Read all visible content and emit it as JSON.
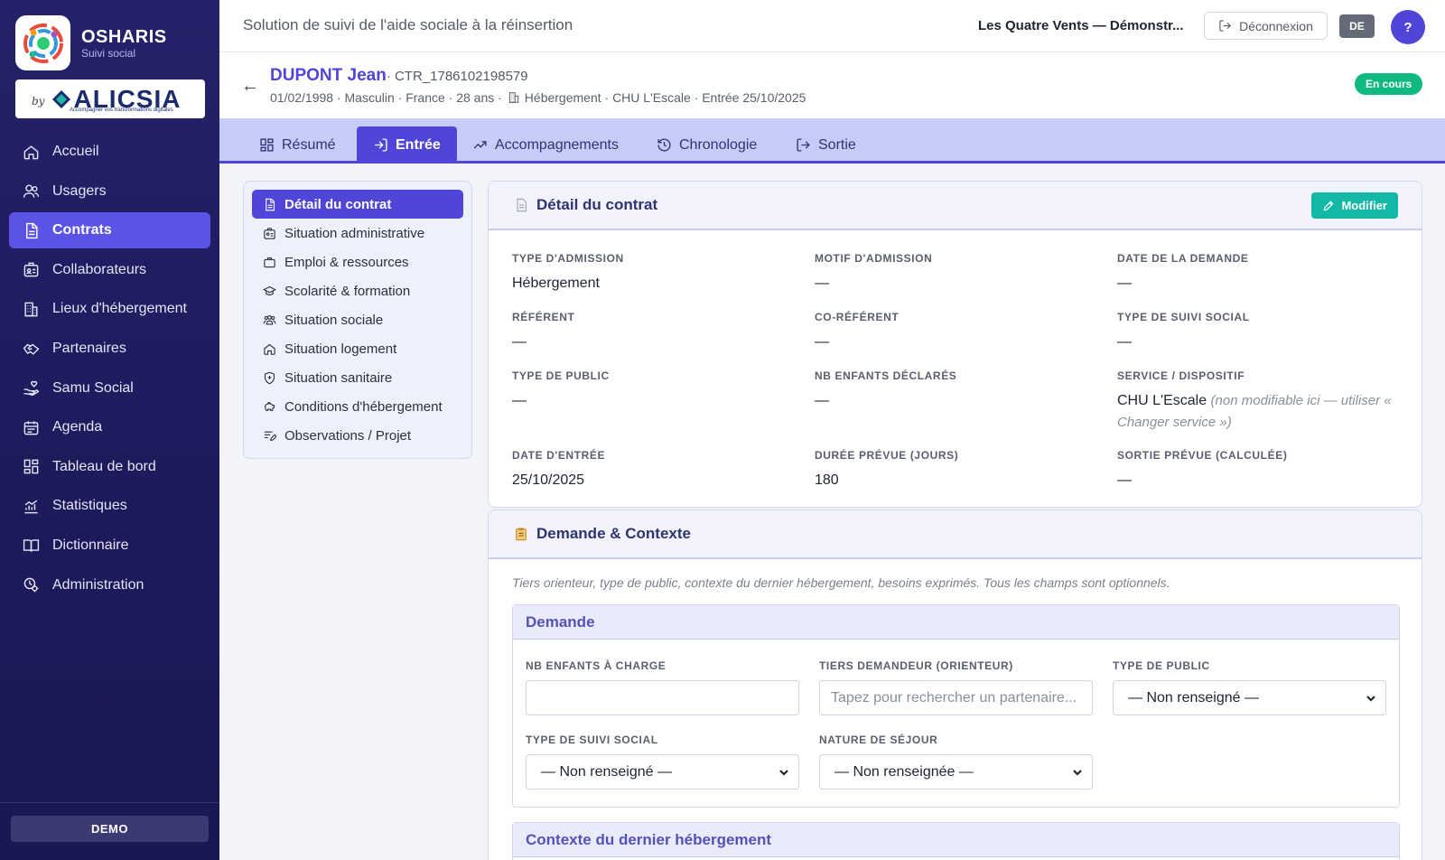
{
  "brand": {
    "name": "OSHARIS",
    "subtitle": "Suivi social",
    "logo_icon": "osharis-logo-icon"
  },
  "partner": {
    "by": "by",
    "name": "ALICSIA",
    "tagline": "Accompagner vos transformations digitales"
  },
  "sidebar": {
    "items": [
      {
        "label": "Accueil",
        "icon": "home-icon"
      },
      {
        "label": "Usagers",
        "icon": "users-icon"
      },
      {
        "label": "Contrats",
        "icon": "document-icon"
      },
      {
        "label": "Collaborateurs",
        "icon": "id-card-icon"
      },
      {
        "label": "Lieux d'hébergement",
        "icon": "building-icon"
      },
      {
        "label": "Partenaires",
        "icon": "handshake-icon"
      },
      {
        "label": "Samu Social",
        "icon": "hand-heart-icon"
      },
      {
        "label": "Agenda",
        "icon": "calendar-icon"
      },
      {
        "label": "Tableau de bord",
        "icon": "dashboard-icon"
      },
      {
        "label": "Statistiques",
        "icon": "stats-icon"
      },
      {
        "label": "Dictionnaire",
        "icon": "book-icon"
      },
      {
        "label": "Administration",
        "icon": "admin-gear-icon"
      }
    ],
    "active_index": 2,
    "demo_label": "DEMO"
  },
  "topbar": {
    "title": "Solution de suivi de l'aide sociale à la réinsertion",
    "org": "Les Quatre Vents — Démonstr...",
    "logout_label": "Déconnexion",
    "lang_label": "DE",
    "help_label": "?"
  },
  "patient": {
    "name": "DUPONT Jean",
    "ref": "· CTR_1786102198579",
    "meta_before": "01/02/1998 · Masculin · France · 28 ans ·",
    "meta_after": "Hébergement · CHU L'Escale · Entrée 25/10/2025",
    "status": "En cours",
    "back_label": "←"
  },
  "tabs": [
    {
      "label": "Résumé",
      "icon": "grid-icon"
    },
    {
      "label": "Entrée",
      "icon": "login-icon"
    },
    {
      "label": "Accompagnements",
      "icon": "trend-icon"
    },
    {
      "label": "Chronologie",
      "icon": "history-icon"
    },
    {
      "label": "Sortie",
      "icon": "logout-icon"
    }
  ],
  "subnav": [
    {
      "label": "Détail du contrat",
      "icon": "document-icon"
    },
    {
      "label": "Situation administrative",
      "icon": "id-card-icon"
    },
    {
      "label": "Emploi & ressources",
      "icon": "briefcase-icon"
    },
    {
      "label": "Scolarité & formation",
      "icon": "graduation-icon"
    },
    {
      "label": "Situation sociale",
      "icon": "people-icon"
    },
    {
      "label": "Situation logement",
      "icon": "home-icon"
    },
    {
      "label": "Situation sanitaire",
      "icon": "shield-icon"
    },
    {
      "label": "Conditions d'hébergement",
      "icon": "piggy-bank-icon"
    },
    {
      "label": "Observations / Projet",
      "icon": "notes-icon"
    }
  ],
  "contract_panel": {
    "title": "Détail du contrat",
    "edit_label": "Modifier",
    "fields": [
      {
        "label": "TYPE D'ADMISSION",
        "value": "Hébergement"
      },
      {
        "label": "MOTIF D'ADMISSION",
        "value": "—"
      },
      {
        "label": "DATE DE LA DEMANDE",
        "value": "—"
      },
      {
        "label": "RÉFÉRENT",
        "value": "—"
      },
      {
        "label": "CO-RÉFÉRENT",
        "value": "—"
      },
      {
        "label": "TYPE DE SUIVI SOCIAL",
        "value": "—"
      },
      {
        "label": "TYPE DE PUBLIC",
        "value": "—"
      },
      {
        "label": "NB ENFANTS DÉCLARÉS",
        "value": "—"
      },
      {
        "label": "SERVICE / DISPOSITIF",
        "value": "CHU L'Escale",
        "note": "(non modifiable ici — utiliser « Changer service »)"
      },
      {
        "label": "DATE D'ENTRÉE",
        "value": "25/10/2025"
      },
      {
        "label": "DURÉE PRÉVUE (JOURS)",
        "value": "180"
      },
      {
        "label": "SORTIE PRÉVUE (CALCULÉE)",
        "value": "—"
      }
    ]
  },
  "context_panel": {
    "title": "Demande & Contexte",
    "intro": "Tiers orienteur, type de public, contexte du dernier hébergement, besoins exprimés. Tous les champs sont optionnels.",
    "group_demande": {
      "title": "Demande",
      "fields": [
        {
          "label": "NB ENFANTS À CHARGE",
          "value": "",
          "placeholder": ""
        },
        {
          "label": "TIERS DEMANDEUR (ORIENTEUR)",
          "value": "",
          "placeholder": "Tapez pour rechercher un partenaire..."
        },
        {
          "label": "TYPE DE PUBLIC",
          "value": "— Non renseigné —"
        },
        {
          "label": "TYPE DE SUIVI SOCIAL",
          "value": "— Non renseigné —"
        },
        {
          "label": "NATURE DE SÉJOUR",
          "value": "— Non renseignée —"
        }
      ]
    },
    "group_contexte": {
      "title": "Contexte du dernier hébergement"
    }
  },
  "colors": {
    "accent": "#4f46d9",
    "sidebar": "#1e1b5e",
    "success": "#10b981",
    "teal": "#14b8a6"
  }
}
